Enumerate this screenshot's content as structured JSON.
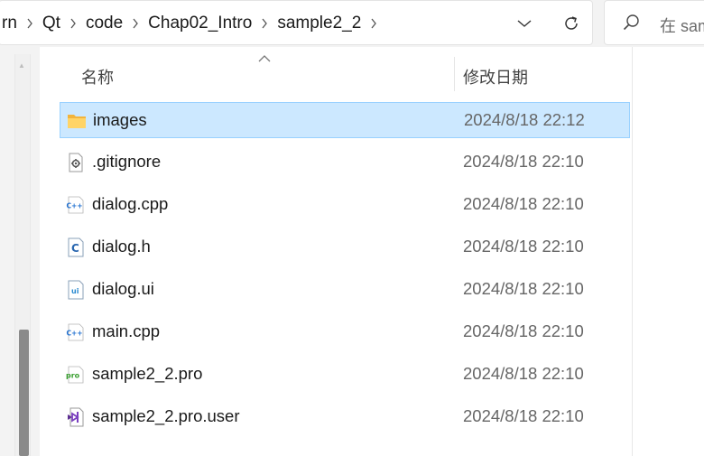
{
  "address": {
    "breadcrumbs": [
      "rn",
      "Qt",
      "code",
      "Chap02_Intro",
      "sample2_2"
    ]
  },
  "search": {
    "placeholder": "在 sam"
  },
  "columns": {
    "name": "名称",
    "date_modified": "修改日期"
  },
  "files": [
    {
      "name": "images",
      "date": "2024/8/18 22:12",
      "icon": "folder-icon",
      "selected": true
    },
    {
      "name": ".gitignore",
      "date": "2024/8/18 22:10",
      "icon": "settings-file-icon"
    },
    {
      "name": "dialog.cpp",
      "date": "2024/8/18 22:10",
      "icon": "cpp-file-icon"
    },
    {
      "name": "dialog.h",
      "date": "2024/8/18 22:10",
      "icon": "c-header-file-icon"
    },
    {
      "name": "dialog.ui",
      "date": "2024/8/18 22:10",
      "icon": "ui-file-icon"
    },
    {
      "name": "main.cpp",
      "date": "2024/8/18 22:10",
      "icon": "cpp-file-icon"
    },
    {
      "name": "sample2_2.pro",
      "date": "2024/8/18 22:10",
      "icon": "pro-file-icon"
    },
    {
      "name": "sample2_2.pro.user",
      "date": "2024/8/18 22:10",
      "icon": "visual-studio-file-icon"
    }
  ],
  "colors": {
    "selection_bg": "#cce8ff",
    "selection_border": "#99d1ff",
    "folder": "#f8c95a",
    "cpp_blue": "#1e6fd0",
    "pro_green": "#3aa031",
    "vs_purple": "#7a3fbf"
  }
}
